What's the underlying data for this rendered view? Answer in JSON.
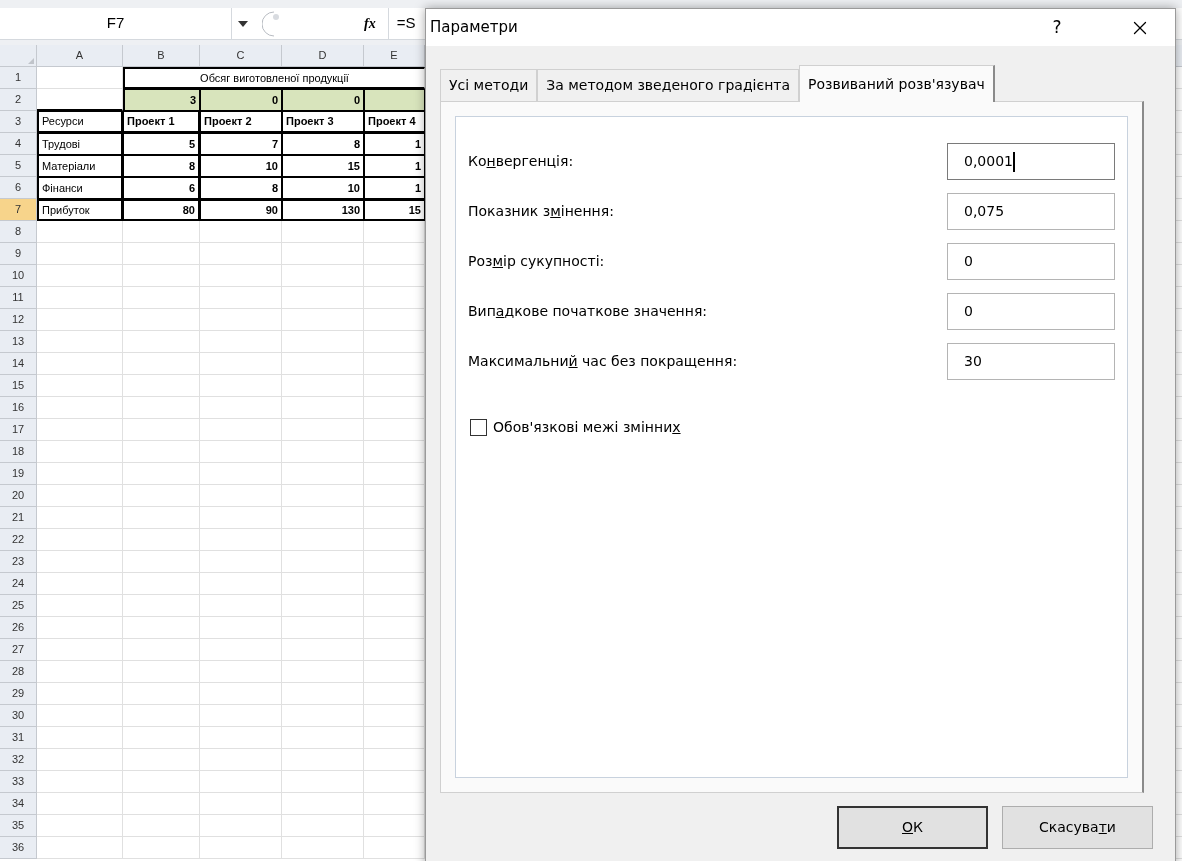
{
  "formula_bar": {
    "name_box": "F7",
    "function_label": "fx",
    "formula": "=S"
  },
  "sheet": {
    "columns": [
      "A",
      "B",
      "C",
      "D",
      "E"
    ],
    "rows": [
      {
        "number": "1",
        "selected": false,
        "cells": [
          {
            "kind": "blank"
          },
          {
            "kind": "title",
            "text": "Обсяг виготовленої продукції"
          }
        ]
      },
      {
        "number": "2",
        "selected": false,
        "cells": [
          {
            "kind": "blank"
          },
          {
            "kind": "input",
            "text": "3"
          },
          {
            "kind": "input",
            "text": "0"
          },
          {
            "kind": "input",
            "text": "0"
          },
          {
            "kind": "input"
          }
        ]
      },
      {
        "number": "3",
        "selected": false,
        "cells": [
          {
            "kind": "label",
            "text": "Ресурси"
          },
          {
            "kind": "header",
            "text": "Проект 1"
          },
          {
            "kind": "header",
            "text": "Проект 2"
          },
          {
            "kind": "header",
            "text": "Проект 3"
          },
          {
            "kind": "header",
            "text": "Проект 4"
          }
        ]
      },
      {
        "number": "4",
        "selected": false,
        "cells": [
          {
            "kind": "label",
            "text": "Трудові"
          },
          {
            "kind": "number",
            "text": "5"
          },
          {
            "kind": "number",
            "text": "7"
          },
          {
            "kind": "number",
            "text": "8"
          },
          {
            "kind": "number",
            "text": "1"
          }
        ]
      },
      {
        "number": "5",
        "selected": false,
        "cells": [
          {
            "kind": "label",
            "text": "Матеріали"
          },
          {
            "kind": "number",
            "text": "8"
          },
          {
            "kind": "number",
            "text": "10"
          },
          {
            "kind": "number",
            "text": "15"
          },
          {
            "kind": "number",
            "text": "1"
          }
        ]
      },
      {
        "number": "6",
        "selected": false,
        "cells": [
          {
            "kind": "label",
            "text": "Фінанси"
          },
          {
            "kind": "number",
            "text": "6"
          },
          {
            "kind": "number",
            "text": "8"
          },
          {
            "kind": "number",
            "text": "10"
          },
          {
            "kind": "number",
            "text": "1"
          }
        ]
      },
      {
        "number": "7",
        "selected": true,
        "cells": [
          {
            "kind": "label",
            "text": "Прибуток"
          },
          {
            "kind": "number",
            "text": "80"
          },
          {
            "kind": "number",
            "text": "90"
          },
          {
            "kind": "number",
            "text": "130"
          },
          {
            "kind": "number",
            "text": "15"
          }
        ]
      },
      {
        "number": "8",
        "selected": false
      },
      {
        "number": "9",
        "selected": false
      },
      {
        "number": "10",
        "selected": false
      },
      {
        "number": "11",
        "selected": false
      },
      {
        "number": "12",
        "selected": false
      },
      {
        "number": "13",
        "selected": false
      },
      {
        "number": "14",
        "selected": false
      },
      {
        "number": "15",
        "selected": false
      },
      {
        "number": "16",
        "selected": false
      },
      {
        "number": "17",
        "selected": false
      },
      {
        "number": "18",
        "selected": false
      },
      {
        "number": "19",
        "selected": false
      },
      {
        "number": "20",
        "selected": false
      },
      {
        "number": "21",
        "selected": false
      },
      {
        "number": "22",
        "selected": false
      },
      {
        "number": "23",
        "selected": false
      },
      {
        "number": "24",
        "selected": false
      },
      {
        "number": "25",
        "selected": false
      },
      {
        "number": "26",
        "selected": false
      },
      {
        "number": "27",
        "selected": false
      },
      {
        "number": "28",
        "selected": false
      },
      {
        "number": "29",
        "selected": false
      },
      {
        "number": "30",
        "selected": false
      },
      {
        "number": "31",
        "selected": false
      },
      {
        "number": "32",
        "selected": false
      },
      {
        "number": "33",
        "selected": false
      },
      {
        "number": "34",
        "selected": false
      },
      {
        "number": "35",
        "selected": false
      },
      {
        "number": "36",
        "selected": false
      }
    ]
  },
  "dialog": {
    "title": "Параметри",
    "help": "?",
    "tabs": [
      {
        "label": "Усі методи",
        "selected": false
      },
      {
        "label": "За методом зведеного градієнта",
        "selected": false
      },
      {
        "label": "Розвиваний розв'язувач",
        "selected": true
      }
    ],
    "fields": [
      {
        "label": [
          {
            "text": "Ко"
          },
          {
            "text": "н",
            "underlined": true
          },
          {
            "text": "вергенція:"
          }
        ],
        "value": "0,0001",
        "focused": true
      },
      {
        "label": [
          {
            "text": "Показник з"
          },
          {
            "text": "м",
            "underlined": true
          },
          {
            "text": "інення:"
          }
        ],
        "value": "0,075",
        "focused": false
      },
      {
        "label": [
          {
            "text": "Роз"
          },
          {
            "text": "м",
            "underlined": true
          },
          {
            "text": "ір сукупності:"
          }
        ],
        "value": "0",
        "focused": false
      },
      {
        "label": [
          {
            "text": "Вип"
          },
          {
            "text": "а",
            "underlined": true
          },
          {
            "text": "дкове початкове значення:"
          }
        ],
        "value": "0",
        "focused": false
      },
      {
        "label": [
          {
            "text": "Максимальни"
          },
          {
            "text": "й",
            "underlined": true
          },
          {
            "text": " час без покращення:"
          }
        ],
        "value": "30",
        "focused": false
      }
    ],
    "checkbox": {
      "label": [
        {
          "text": "Обов'язкові межі змінни"
        },
        {
          "text": "х",
          "underlined": true
        }
      ],
      "checked": false
    },
    "buttons": [
      {
        "label": [
          {
            "text": "О",
            "underlined": true
          },
          {
            "text": "К"
          }
        ],
        "default": true
      },
      {
        "label": [
          {
            "text": "Скасува"
          },
          {
            "text": "т",
            "underlined": true
          },
          {
            "text": "и"
          }
        ],
        "default": false
      }
    ]
  }
}
